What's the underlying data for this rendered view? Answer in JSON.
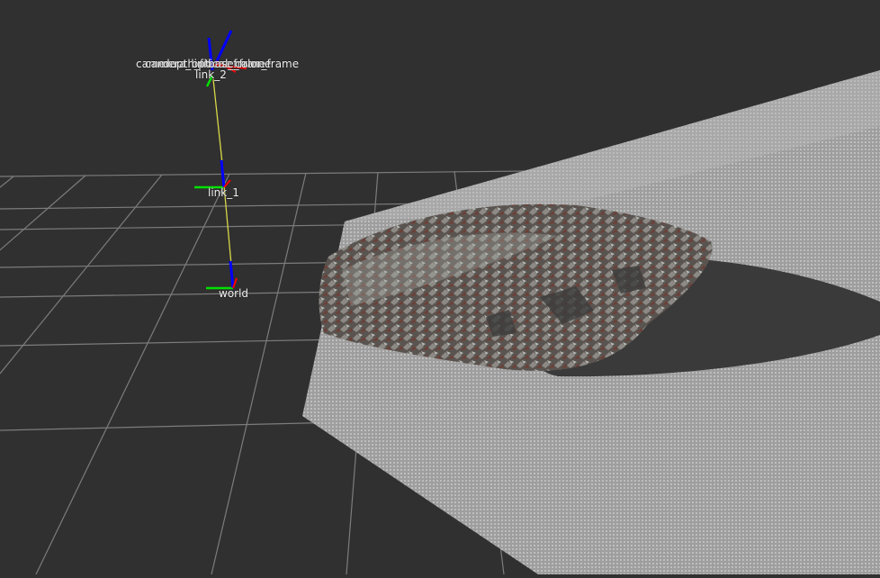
{
  "scene": {
    "background": "#303030",
    "grid_color": "#8a8a8a",
    "plane_color": "#9e9e9e"
  },
  "frames": {
    "world": "world",
    "link_1": "link_1",
    "link_2": "link_2",
    "overlapping": [
      "camera",
      "camera_link",
      "depth_frame",
      "optical_frame",
      "base_frame",
      "color_frame"
    ]
  },
  "axis_colors": {
    "x": "#ff0000",
    "y": "#00e000",
    "z": "#0000ff",
    "link": "#d8d84a"
  }
}
